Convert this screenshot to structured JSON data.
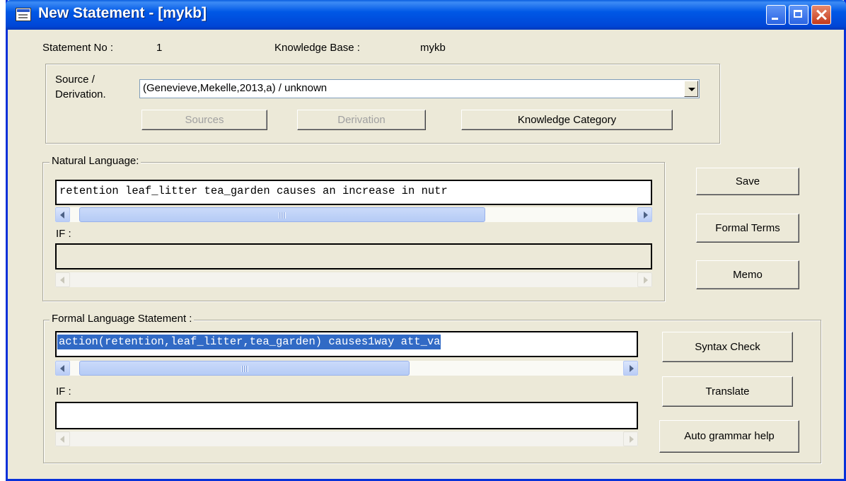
{
  "window": {
    "title": "New Statement - [mykb]"
  },
  "header": {
    "statement_no_label": "Statement No :",
    "statement_no_value": "1",
    "kb_label": "Knowledge Base :",
    "kb_value": "mykb"
  },
  "source": {
    "label_line1": "Source  /",
    "label_line2": "Derivation.",
    "selected": "(Genevieve,Mekelle,2013,a) / unknown",
    "buttons": {
      "sources": "Sources",
      "derivation": "Derivation",
      "knowledge_category": "Knowledge Category"
    }
  },
  "natural_language": {
    "title": "Natural Language:",
    "value": "retention leaf_litter tea_garden causes  an increase in nutr",
    "if_label": "IF :",
    "if_value": ""
  },
  "formal_language": {
    "title": "Formal Language Statement :",
    "value": "action(retention,leaf_litter,tea_garden) causes1way att_va",
    "if_label": "IF :",
    "if_value": ""
  },
  "actions": {
    "save": "Save",
    "formal_terms": "Formal Terms",
    "memo": "Memo",
    "syntax_check": "Syntax Check",
    "translate": "Translate",
    "auto_grammar_help": "Auto grammar help"
  },
  "colors": {
    "title_bar": "#0054e3",
    "dialog_face": "#ece9d8",
    "selection": "#316ac5"
  }
}
